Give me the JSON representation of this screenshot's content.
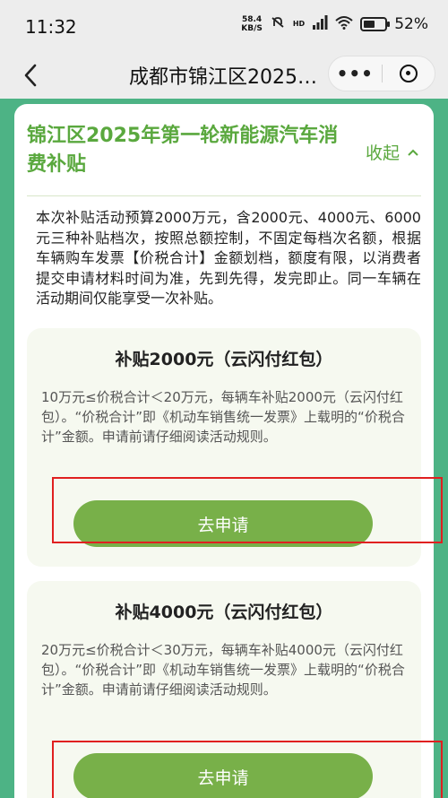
{
  "status_bar": {
    "time": "11:32",
    "net_speed_value": "58.4",
    "net_speed_unit": "KB/S",
    "network": "HD",
    "battery_percent": "52%",
    "battery_level": 0.52
  },
  "nav": {
    "title": "成都市锦江区2025…",
    "more_label": "•••"
  },
  "card": {
    "title": "锦江区2025年第一轮新能源汽车消费补贴",
    "collapse_label": "收起",
    "collapse_icon": "chevron-up-icon",
    "intro": "本次补贴活动预算2000万元，含2000元、4000元、6000元三种补贴档次，按照总额控制，不固定每档次名额，根据车辆购车发票【价税合计】金额划档，额度有限，以消费者提交申请材料时间为准，先到先得，发完即止。同一车辆在活动期间仅能享受一次补贴。"
  },
  "tiers": [
    {
      "title": "补贴2000元（云闪付红包）",
      "description": "10万元≤价税合计＜20万元，每辆车补贴2000元（云闪付红包）。“价税合计”即《机动车销售统一发票》上载明的“价税合计”金额。申请前请仔细阅读活动规则。",
      "button_label": "去申请"
    },
    {
      "title": "补贴4000元（云闪付红包）",
      "description": "20万元≤价税合计＜30万元，每辆车补贴4000元（云闪付红包）。“价税合计”即《机动车销售统一发票》上载明的“价税合计”金额。申请前请仔细阅读活动规则。",
      "button_label": "去申请"
    }
  ],
  "colors": {
    "page_bg": "#4db385",
    "accent_green": "#5aa83e",
    "button_green": "#78b049",
    "highlight_red": "#e02020"
  }
}
